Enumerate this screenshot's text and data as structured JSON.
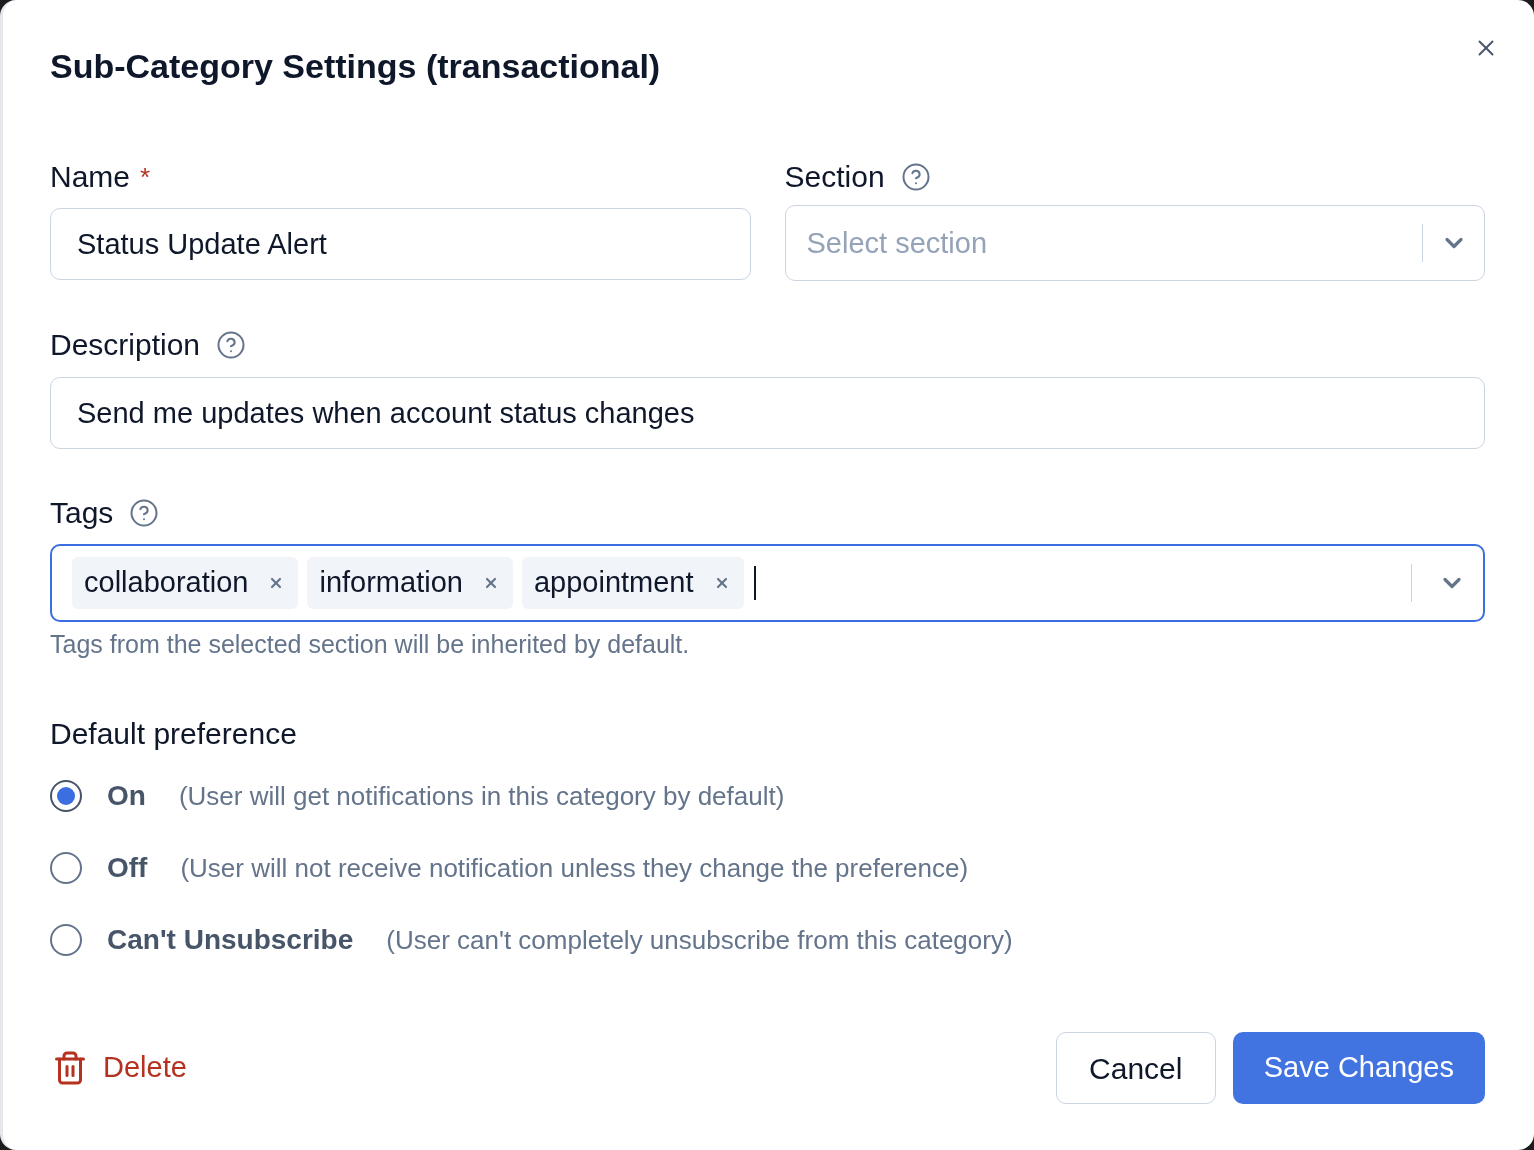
{
  "dialog": {
    "title": "Sub-Category Settings (transactional)"
  },
  "name_field": {
    "label": "Name",
    "required_mark": "*",
    "value": "Status Update Alert"
  },
  "section_field": {
    "label": "Section",
    "help": true,
    "placeholder": "Select section"
  },
  "description_field": {
    "label": "Description",
    "help": true,
    "value": "Send me updates when account status changes"
  },
  "tags_field": {
    "label": "Tags",
    "help": true,
    "focused": true,
    "tags": [
      "collaboration",
      "information",
      "appointment"
    ],
    "hint": "Tags from the selected section will be inherited by default."
  },
  "default_preference": {
    "title": "Default preference",
    "options": [
      {
        "label": "On",
        "description": "(User will get notifications in this category by default)",
        "selected": true
      },
      {
        "label": "Off",
        "description": "(User will not receive notification unless they change the preference)",
        "selected": false
      },
      {
        "label": "Can't Unsubscribe",
        "description": "(User can't completely unsubscribe from this category)",
        "selected": false
      }
    ]
  },
  "footer": {
    "delete": "Delete",
    "cancel": "Cancel",
    "save": "Save Changes"
  }
}
